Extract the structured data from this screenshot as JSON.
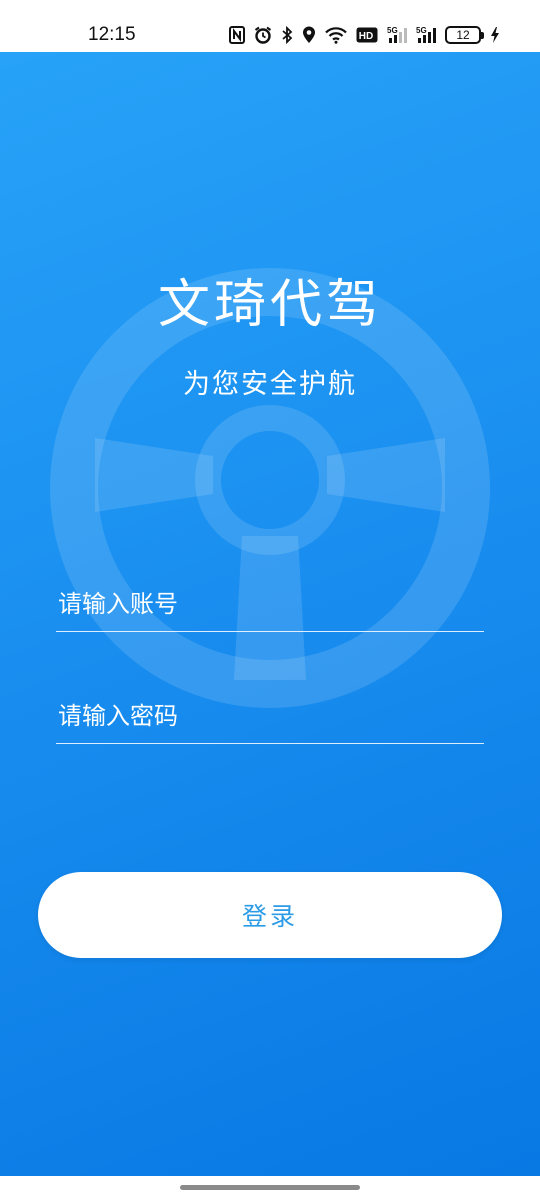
{
  "status_bar": {
    "time": "12:15",
    "battery_level": "12",
    "icons": [
      "nfc-icon",
      "alarm-icon",
      "bluetooth-icon",
      "location-icon",
      "wifi-icon",
      "hd-icon",
      "signal-5g-icon",
      "signal-5g-icon",
      "battery-icon",
      "charging-icon"
    ]
  },
  "app": {
    "title": "文琦代驾",
    "subtitle": "为您安全护航",
    "background_colors": [
      "#27a2f8",
      "#0878e3"
    ]
  },
  "form": {
    "account_placeholder": "请输入账号",
    "account_value": "",
    "password_placeholder": "请输入密码",
    "password_value": "",
    "login_label": "登录",
    "button_text_color": "#2c9be6"
  }
}
